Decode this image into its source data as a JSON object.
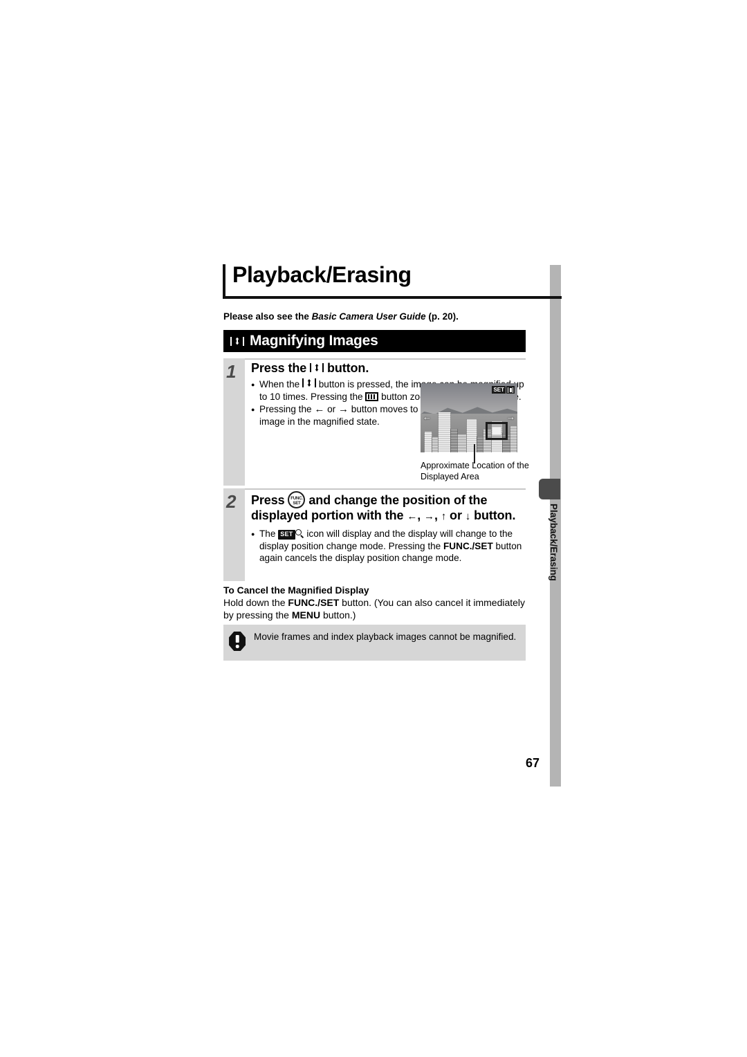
{
  "chapter": {
    "title": "Playback/Erasing"
  },
  "see_also": {
    "prefix": "Please also see the ",
    "italic": "Basic Camera User Guide",
    "suffix": " (p. 20)."
  },
  "section": {
    "icon": "magnify-button-icon",
    "title": "Magnifying Images"
  },
  "steps": [
    {
      "number": "1",
      "heading_before": "Press the ",
      "heading_icon": "magnify-button-icon",
      "heading_after": " button.",
      "bullets": [
        {
          "parts": [
            "When the ",
            "[magnify-button-icon]",
            " button is pressed, the image can be magnified up to 10 times. Pressing the ",
            "[wide-angle-icon]",
            " button zooms out from the image."
          ],
          "text_1": "When the ",
          "text_2": " button is pressed, the image can be magnified up to 10 times. Pressing the ",
          "text_3": " button zooms out from the image."
        },
        {
          "text_1": "Pressing the ",
          "arrow_left": "←",
          "text_2": " or ",
          "arrow_right": "→",
          "text_3": " button moves to the previous or next image in the magnified state."
        }
      ]
    },
    {
      "number": "2",
      "heading_1": "Press ",
      "heading_icon": "func-set-button-icon",
      "heading_2": " and change the position of the displayed portion with the ",
      "arrow_left": "←",
      "sep1": ", ",
      "arrow_right": "→",
      "sep2": ", ",
      "arrow_up": "↑",
      "sep3": " or ",
      "arrow_down": "↓",
      "heading_3": " button.",
      "bullet": {
        "text_1": "The ",
        "badge": "SET",
        "loupe": "magnifier-icon",
        "text_2": " icon will display and the display will change to the display position change mode. Pressing the ",
        "bold_1": "FUNC./SET",
        "text_3": " button again cancels the display position change mode."
      }
    }
  ],
  "figure": {
    "lcd_badge_set": "SET",
    "lcd_badge_icon": "magnify-button-icon",
    "arrow_left": "←",
    "arrow_right": "→",
    "location_box": "displayed-area-indicator",
    "caption": "Approximate Location of the Displayed Area"
  },
  "cancel_section": {
    "heading": "To Cancel the Magnified Display",
    "text_1": "Hold down the ",
    "bold_1": "FUNC./SET",
    "text_2": " button. (You can also cancel it immediately by pressing the ",
    "bold_2": "MENU",
    "text_3": " button.)"
  },
  "note": {
    "icon": "caution-exclamation-icon",
    "text": "Movie frames and index playback images cannot be magnified."
  },
  "side_tab": {
    "label": "Playback/Erasing"
  },
  "page_number": "67",
  "colors": {
    "bar_black": "#000000",
    "step_col_gray": "#d6d6d6",
    "note_gray": "#d6d6d6",
    "spine_gray": "#b4b4b4",
    "tab_dark": "#4b4b4b"
  }
}
